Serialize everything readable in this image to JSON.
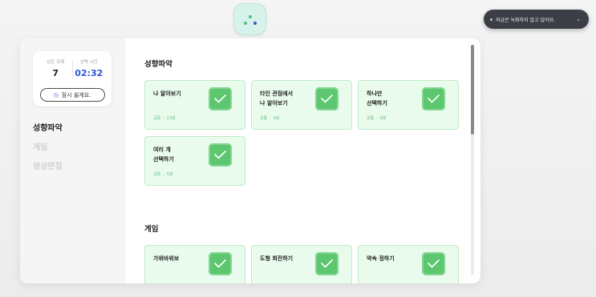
{
  "recording": {
    "text": "지금은 녹화하지 않고 있어요."
  },
  "status": {
    "remaining_label": "남은 과제",
    "remaining_value": "7",
    "time_label": "선택 시간",
    "time_value": "02:32",
    "rest_label": "잠시 쉴게요."
  },
  "sidebar": {
    "items": [
      {
        "label": "성향파악",
        "active": true
      },
      {
        "label": "게임",
        "active": false
      },
      {
        "label": "영상면접",
        "active": false
      }
    ]
  },
  "sections": [
    {
      "title": "성향파악",
      "cards": [
        {
          "title_lines": [
            "나 알아보기"
          ],
          "type": "공통",
          "duration": "13분"
        },
        {
          "title_lines": [
            "타인 관점에서",
            "나 알아보기"
          ],
          "type": "공통",
          "duration": "6분"
        },
        {
          "title_lines": [
            "하나만",
            "선택하기"
          ],
          "type": "공통",
          "duration": "6분"
        },
        {
          "title_lines": [
            "여러 개",
            "선택하기"
          ],
          "type": "공통",
          "duration": "5분"
        }
      ]
    },
    {
      "title": "게임",
      "cards": [
        {
          "title_lines": [
            "가위바위보"
          ]
        },
        {
          "title_lines": [
            "도형 회전하기"
          ]
        },
        {
          "title_lines": [
            "약속 정하기"
          ]
        }
      ]
    }
  ],
  "icons": {
    "logo": "app-logo-icon",
    "check": "check-icon",
    "clock": "clock-icon",
    "chevron": "chevron-down-icon"
  },
  "colors": {
    "accent_green": "#5cc76e",
    "card_bg": "#e9fbed",
    "time_blue": "#2c57d8",
    "pill_bg": "#3b3f45"
  },
  "scroll": {
    "thumb_fraction": 0.39
  }
}
